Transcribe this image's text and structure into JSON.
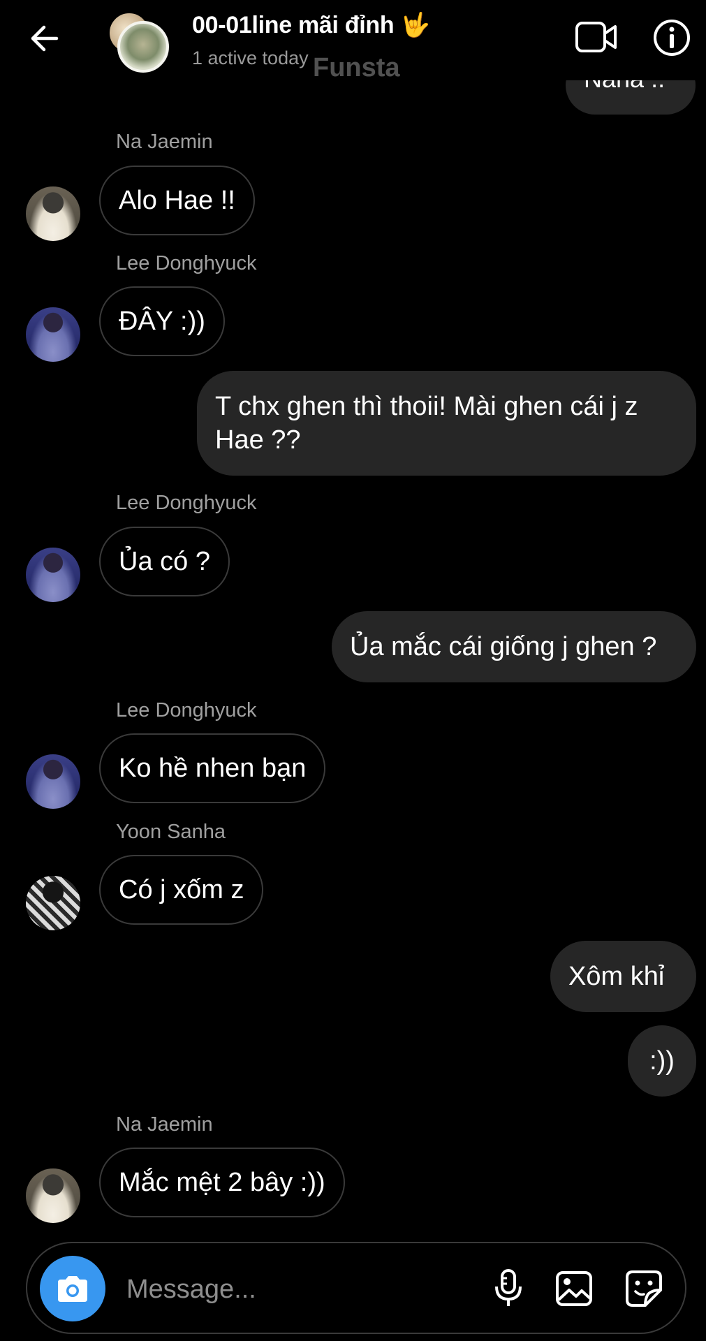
{
  "header": {
    "title": "00-01line mãi đỉnh",
    "title_emoji": "🤟",
    "subtitle": "1 active today",
    "watermark": "Funsta"
  },
  "partial_message": "Nana ..",
  "messages": [
    {
      "sender": "Na Jaemin",
      "text": "Alo Hae !!"
    },
    {
      "sender": "Lee Donghyuck",
      "text": "ĐÂY :))"
    },
    {
      "text": "T chx ghen thì thoii! Mài ghen cái j z Hae ??"
    },
    {
      "sender": "Lee Donghyuck",
      "text": "Ủa có ?"
    },
    {
      "text": "Ủa mắc cái giống j ghen ?"
    },
    {
      "sender": "Lee Donghyuck",
      "text": "Ko hề nhen bạn"
    },
    {
      "sender": "Yoon Sanha",
      "text": "Có j xốm z"
    },
    {
      "text": "Xôm khỉ"
    },
    {
      "text": ":))"
    },
    {
      "sender": "Na Jaemin",
      "text": "Mắc mệt 2 bây :))"
    }
  ],
  "composer": {
    "placeholder": "Message..."
  },
  "colors": {
    "background": "#000000",
    "outgoing_bubble": "#262626",
    "camera_button": "#3897f0",
    "secondary_text": "#a0a0a0"
  },
  "icons": [
    "back-arrow-icon",
    "video-call-icon",
    "info-icon",
    "camera-icon",
    "microphone-icon",
    "gallery-icon",
    "sticker-icon"
  ]
}
